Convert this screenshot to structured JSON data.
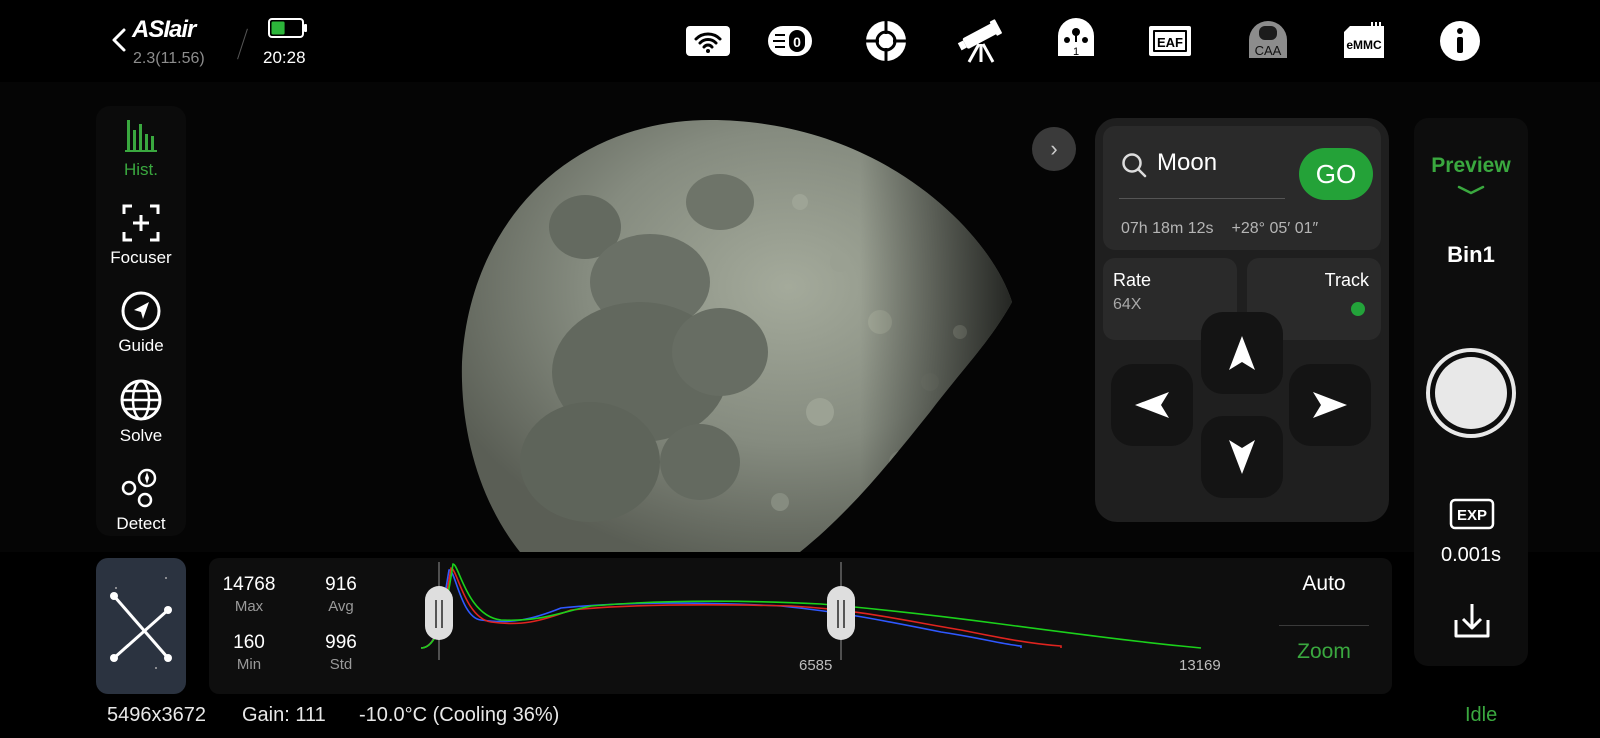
{
  "header": {
    "logo": "ASIair",
    "version": "2.3(11.56)",
    "time": "20:28",
    "battery_level": 0.45,
    "icons": [
      "wifi-icon",
      "filter-wheel-icon",
      "guide-scope-icon",
      "telescope-icon",
      "camera-1-icon",
      "eaf-icon",
      "caa-icon",
      "emmc-icon",
      "info-icon"
    ],
    "icon_labels": {
      "camera": "1",
      "eaf": "EAF",
      "caa": "CAA",
      "emmc": "eMMC"
    }
  },
  "left_tools": [
    {
      "label": "Hist.",
      "icon": "histogram-icon",
      "active": true
    },
    {
      "label": "Focuser",
      "icon": "focuser-icon",
      "active": false
    },
    {
      "label": "Guide",
      "icon": "guide-icon",
      "active": false
    },
    {
      "label": "Solve",
      "icon": "solve-globe-icon",
      "active": false
    },
    {
      "label": "Detect",
      "icon": "detect-icon",
      "active": false
    }
  ],
  "goto": {
    "search_value": "Moon",
    "go_label": "GO",
    "ra": "07h 18m 12s",
    "dec": "+28° 05′ 01″"
  },
  "mount": {
    "rate_label": "Rate",
    "rate_value": "64X",
    "track_label": "Track",
    "track_on": true
  },
  "capture": {
    "mode": "Preview",
    "bin": "Bin1",
    "exp_label": "EXP",
    "exposure": "0.001s"
  },
  "histogram": {
    "stats": {
      "max_value": "14768",
      "max_label": "Max",
      "avg_value": "916",
      "avg_label": "Avg",
      "min_value": "160",
      "min_label": "Min",
      "std_value": "996",
      "std_label": "Std"
    },
    "axis": {
      "min": "0",
      "mid": "6585",
      "max": "13169"
    },
    "auto_label": "Auto",
    "zoom_label": "Zoom",
    "colors": {
      "red": "#e0241f",
      "green": "#1bd11b",
      "blue": "#2f58ff"
    }
  },
  "status_bar": {
    "resolution": "5496x3672",
    "gain": "Gain: 111",
    "temperature": "-10.0°C (Cooling 36%)",
    "state": "Idle"
  },
  "theme": {
    "accent_green": "#3aa83f",
    "go_green": "#24a238"
  }
}
